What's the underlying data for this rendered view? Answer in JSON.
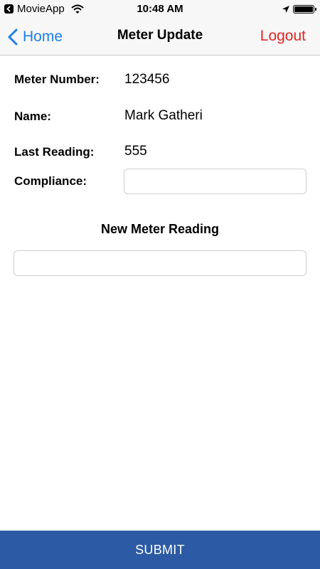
{
  "status_bar": {
    "back_app": "MovieApp",
    "time": "10:48 AM"
  },
  "nav": {
    "back_label": "Home",
    "title": "Meter Update",
    "logout_label": "Logout"
  },
  "meter": {
    "number_label": "Meter Number:",
    "number_value": "123456",
    "name_label": "Name:",
    "name_value": "Mark Gatheri",
    "last_reading_label": "Last Reading:",
    "last_reading_value": "555",
    "compliance_label": "Compliance:",
    "compliance_value": "",
    "compliance_placeholder": ""
  },
  "new_reading": {
    "title": "New Meter Reading",
    "value": "",
    "placeholder": ""
  },
  "submit_label": "SUBMIT",
  "colors": {
    "accent": "#1e7ee6",
    "logout": "#e02626",
    "submit_bg": "#2c5aa4"
  }
}
